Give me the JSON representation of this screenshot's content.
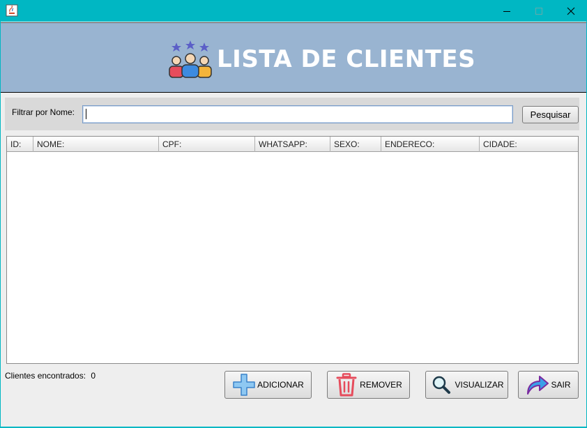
{
  "window": {
    "title": "",
    "controls": {
      "minimize": "minimize",
      "maximize": "maximize",
      "close": "close"
    }
  },
  "header": {
    "title": "LISTA DE CLIENTES",
    "icon": "customers-stars-icon"
  },
  "filter": {
    "label": "Filtrar por Nome:",
    "value": "",
    "placeholder": "",
    "search_button": "Pesquisar"
  },
  "table": {
    "columns": [
      "ID:",
      "NOME:",
      "CPF:",
      "WHATSAPP:",
      "SEXO:",
      "ENDERECO:",
      "CIDADE:"
    ],
    "rows": []
  },
  "status": {
    "label": "Clientes encontrados:",
    "count": "0"
  },
  "actions": {
    "add": {
      "label": "ADICIONAR",
      "icon": "plus-icon"
    },
    "remove": {
      "label": "REMOVER",
      "icon": "trash-icon"
    },
    "view": {
      "label": "VISUALIZAR",
      "icon": "magnifier-icon"
    },
    "exit": {
      "label": "SAIR",
      "icon": "share-arrow-icon"
    }
  },
  "colors": {
    "titlebar": "#00b7c3",
    "header_bg": "#99b4d1",
    "filter_bg": "#d9d9d9"
  }
}
